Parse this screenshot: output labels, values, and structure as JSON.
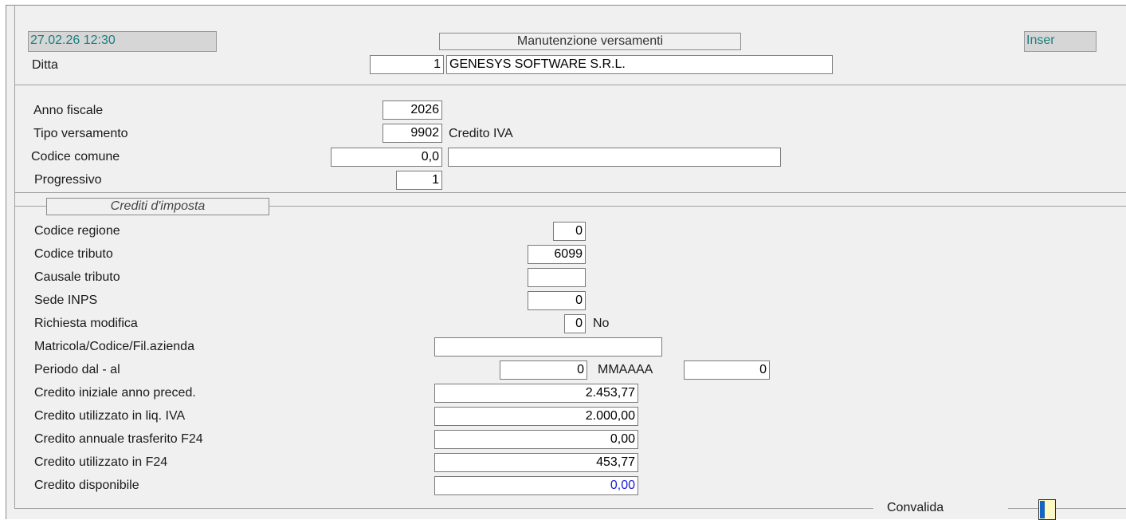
{
  "header": {
    "datetime": "27.02.26 12:30",
    "title": "Manutenzione versamenti",
    "mode": "Inser"
  },
  "ditta": {
    "label": "Ditta",
    "code": "1",
    "name": "GENESYS SOFTWARE S.R.L."
  },
  "general": {
    "anno_fiscale": {
      "label": "Anno fiscale",
      "value": "2026"
    },
    "tipo_versamento": {
      "label": "Tipo versamento",
      "value": "9902",
      "desc": "Credito IVA"
    },
    "codice_comune": {
      "label": "Codice comune",
      "value": "0,0",
      "desc": ""
    },
    "progressivo": {
      "label": "Progressivo",
      "value": "1"
    }
  },
  "crediti": {
    "section_title": "Crediti d'imposta",
    "codice_regione": {
      "label": "Codice regione",
      "value": "0"
    },
    "codice_tributo": {
      "label": "Codice tributo",
      "value": "6099"
    },
    "causale_tributo": {
      "label": "Causale tributo",
      "value": ""
    },
    "sede_inps": {
      "label": "Sede INPS",
      "value": "0"
    },
    "richiesta_modifica": {
      "label": "Richiesta modifica",
      "value": "0",
      "desc": "No"
    },
    "matricola": {
      "label": "Matricola/Codice/Fil.azienda",
      "value": ""
    },
    "periodo": {
      "label": "Periodo dal - al",
      "dal": "0",
      "format": "MMAAAA",
      "al": "0"
    },
    "credito_iniziale": {
      "label": "Credito iniziale anno preced.",
      "value": "2.453,77"
    },
    "credito_liq_iva": {
      "label": "Credito utilizzato in liq. IVA",
      "value": "2.000,00"
    },
    "credito_trasferito": {
      "label": "Credito annuale trasferito F24",
      "value": "0,00"
    },
    "credito_f24": {
      "label": "Credito utilizzato in F24",
      "value": "453,77"
    },
    "credito_disponibile": {
      "label": "Credito disponibile",
      "value": "0,00"
    }
  },
  "footer": {
    "convalida_label": "Convalida"
  },
  "colors": {
    "teal_text": "#1a7f7f",
    "blue_value": "#1a1ad6",
    "button_yellow": "#fff8c4",
    "button_blue": "#1565c0"
  }
}
